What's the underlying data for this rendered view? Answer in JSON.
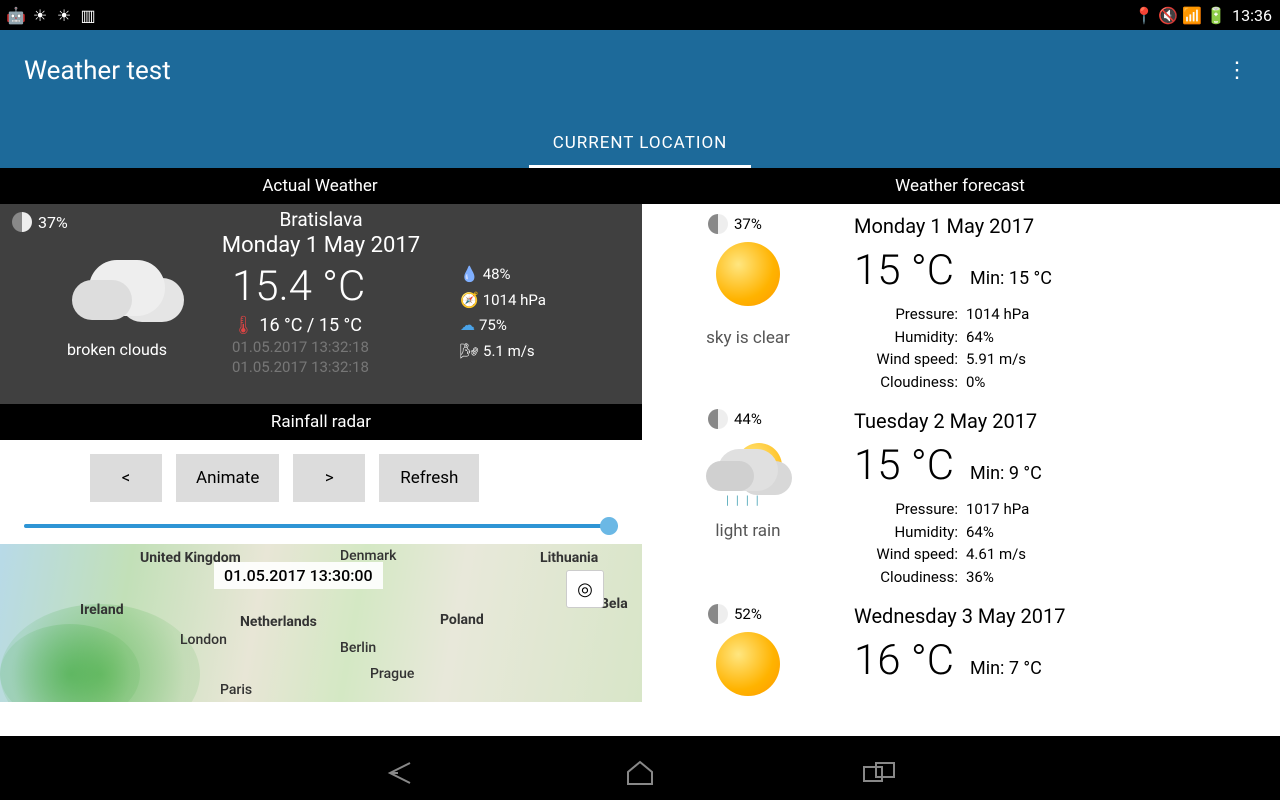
{
  "status": {
    "time": "13:36"
  },
  "header": {
    "title": "Weather test",
    "tab": "CURRENT LOCATION"
  },
  "sections": {
    "left": "Actual Weather",
    "right": "Weather forecast"
  },
  "actual": {
    "moon": "37%",
    "city": "Bratislava",
    "date": "Monday 1 May 2017",
    "temp": "15.4 °C",
    "range": "16 °C / 15 °C",
    "ts1": "01.05.2017 13:32:18",
    "ts2": "01.05.2017 13:32:18",
    "cond": "broken clouds",
    "humidity": "48%",
    "pressure": "1014 hPa",
    "cloudiness": "75%",
    "wind": "5.1 m/s"
  },
  "radar": {
    "title": "Rainfall radar",
    "prev": "<",
    "animate": "Animate",
    "next": ">",
    "refresh": "Refresh",
    "map_ts": "01.05.2017 13:30:00"
  },
  "map_labels": {
    "uk": "United Kingdom",
    "ireland": "Ireland",
    "denmark": "Denmark",
    "lithuania": "Lithuania",
    "bela": "Bela",
    "netherlands": "Netherlands",
    "poland": "Poland",
    "london": "London",
    "berlin": "Berlin",
    "prague": "Prague",
    "paris": "Paris"
  },
  "forecast": [
    {
      "moon": "37%",
      "date": "Monday 1 May 2017",
      "temp": "15 °C",
      "min": "Min: 15 °C",
      "cond": "sky is clear",
      "icon": "sun",
      "pressure_lbl": "Pressure:",
      "pressure": "1014 hPa",
      "humidity_lbl": "Humidity:",
      "humidity": "64%",
      "wind_lbl": "Wind speed:",
      "wind": "5.91 m/s",
      "cloud_lbl": "Cloudiness:",
      "cloud": "0%"
    },
    {
      "moon": "44%",
      "date": "Tuesday 2 May 2017",
      "temp": "15 °C",
      "min": "Min: 9 °C",
      "cond": "light rain",
      "icon": "raincloud",
      "pressure_lbl": "Pressure:",
      "pressure": "1017 hPa",
      "humidity_lbl": "Humidity:",
      "humidity": "64%",
      "wind_lbl": "Wind speed:",
      "wind": "4.61 m/s",
      "cloud_lbl": "Cloudiness:",
      "cloud": "36%"
    },
    {
      "moon": "52%",
      "date": "Wednesday 3 May 2017",
      "temp": "16 °C",
      "min": "Min: 7 °C",
      "cond": "",
      "icon": "sun",
      "pressure_lbl": "",
      "pressure": "",
      "humidity_lbl": "",
      "humidity": "",
      "wind_lbl": "",
      "wind": "",
      "cloud_lbl": "",
      "cloud": ""
    }
  ]
}
